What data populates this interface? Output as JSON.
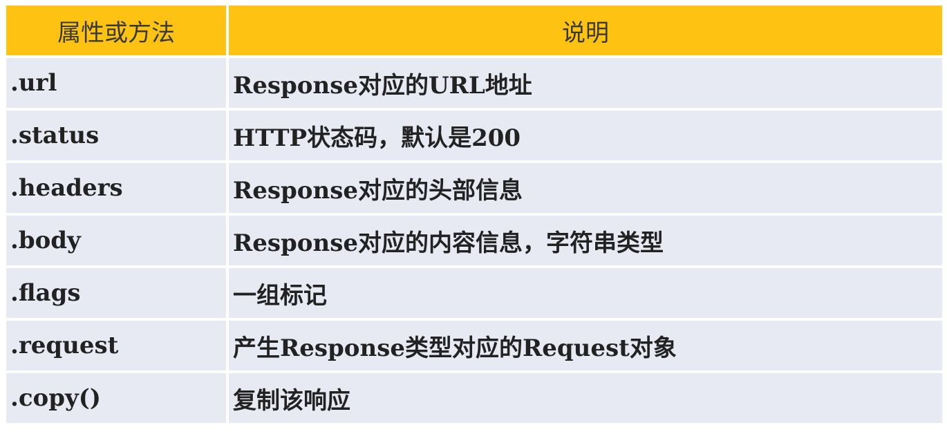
{
  "table": {
    "headers": {
      "col1": "属性或方法",
      "col2": "说明"
    },
    "rows": [
      {
        "name": ".url",
        "desc": "Response对应的URL地址"
      },
      {
        "name": ".status",
        "desc": "HTTP状态码，默认是200"
      },
      {
        "name": ".headers",
        "desc": "Response对应的头部信息"
      },
      {
        "name": ".body",
        "desc": "Response对应的内容信息，字符串类型"
      },
      {
        "name": ".flags",
        "desc": "一组标记"
      },
      {
        "name": ".request",
        "desc": "产生Response类型对应的Request对象"
      },
      {
        "name": ".copy()",
        "desc": "复制该响应"
      }
    ]
  },
  "colors": {
    "header_bg": "#fec312",
    "row_bg": "#e8eaf3"
  }
}
